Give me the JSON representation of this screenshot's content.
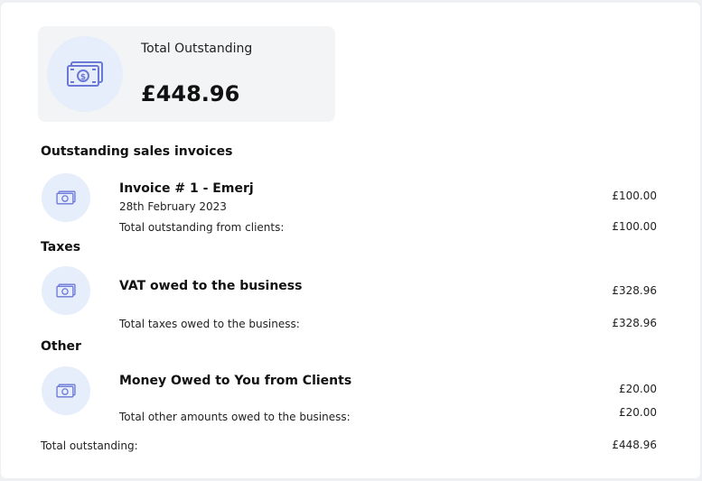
{
  "summary": {
    "label": "Total Outstanding",
    "amount": "£448.96",
    "icon": "cash-icon"
  },
  "sales": {
    "title": "Outstanding sales invoices",
    "invoice": {
      "title": "Invoice # 1 - Emerj",
      "date": "28th February 2023",
      "amount": "£100.00"
    },
    "total_label": "Total outstanding from clients:",
    "total_amount": "£100.00"
  },
  "taxes": {
    "title": "Taxes",
    "item": {
      "title": "VAT owed to the business",
      "amount": "£328.96"
    },
    "total_label": "Total taxes owed to the business:",
    "total_amount": "£328.96"
  },
  "other": {
    "title": "Other",
    "item": {
      "title": "Money Owed to You from Clients",
      "amount": "£20.00"
    },
    "total_label": "Total other amounts owed to the business:",
    "total_amount": "£20.00"
  },
  "grand_total": {
    "label": "Total outstanding:",
    "amount": "£448.96"
  },
  "colors": {
    "accent": "#6b78d6",
    "circle_bg": "#e6edfb",
    "summary_bg": "#f3f4f6"
  }
}
